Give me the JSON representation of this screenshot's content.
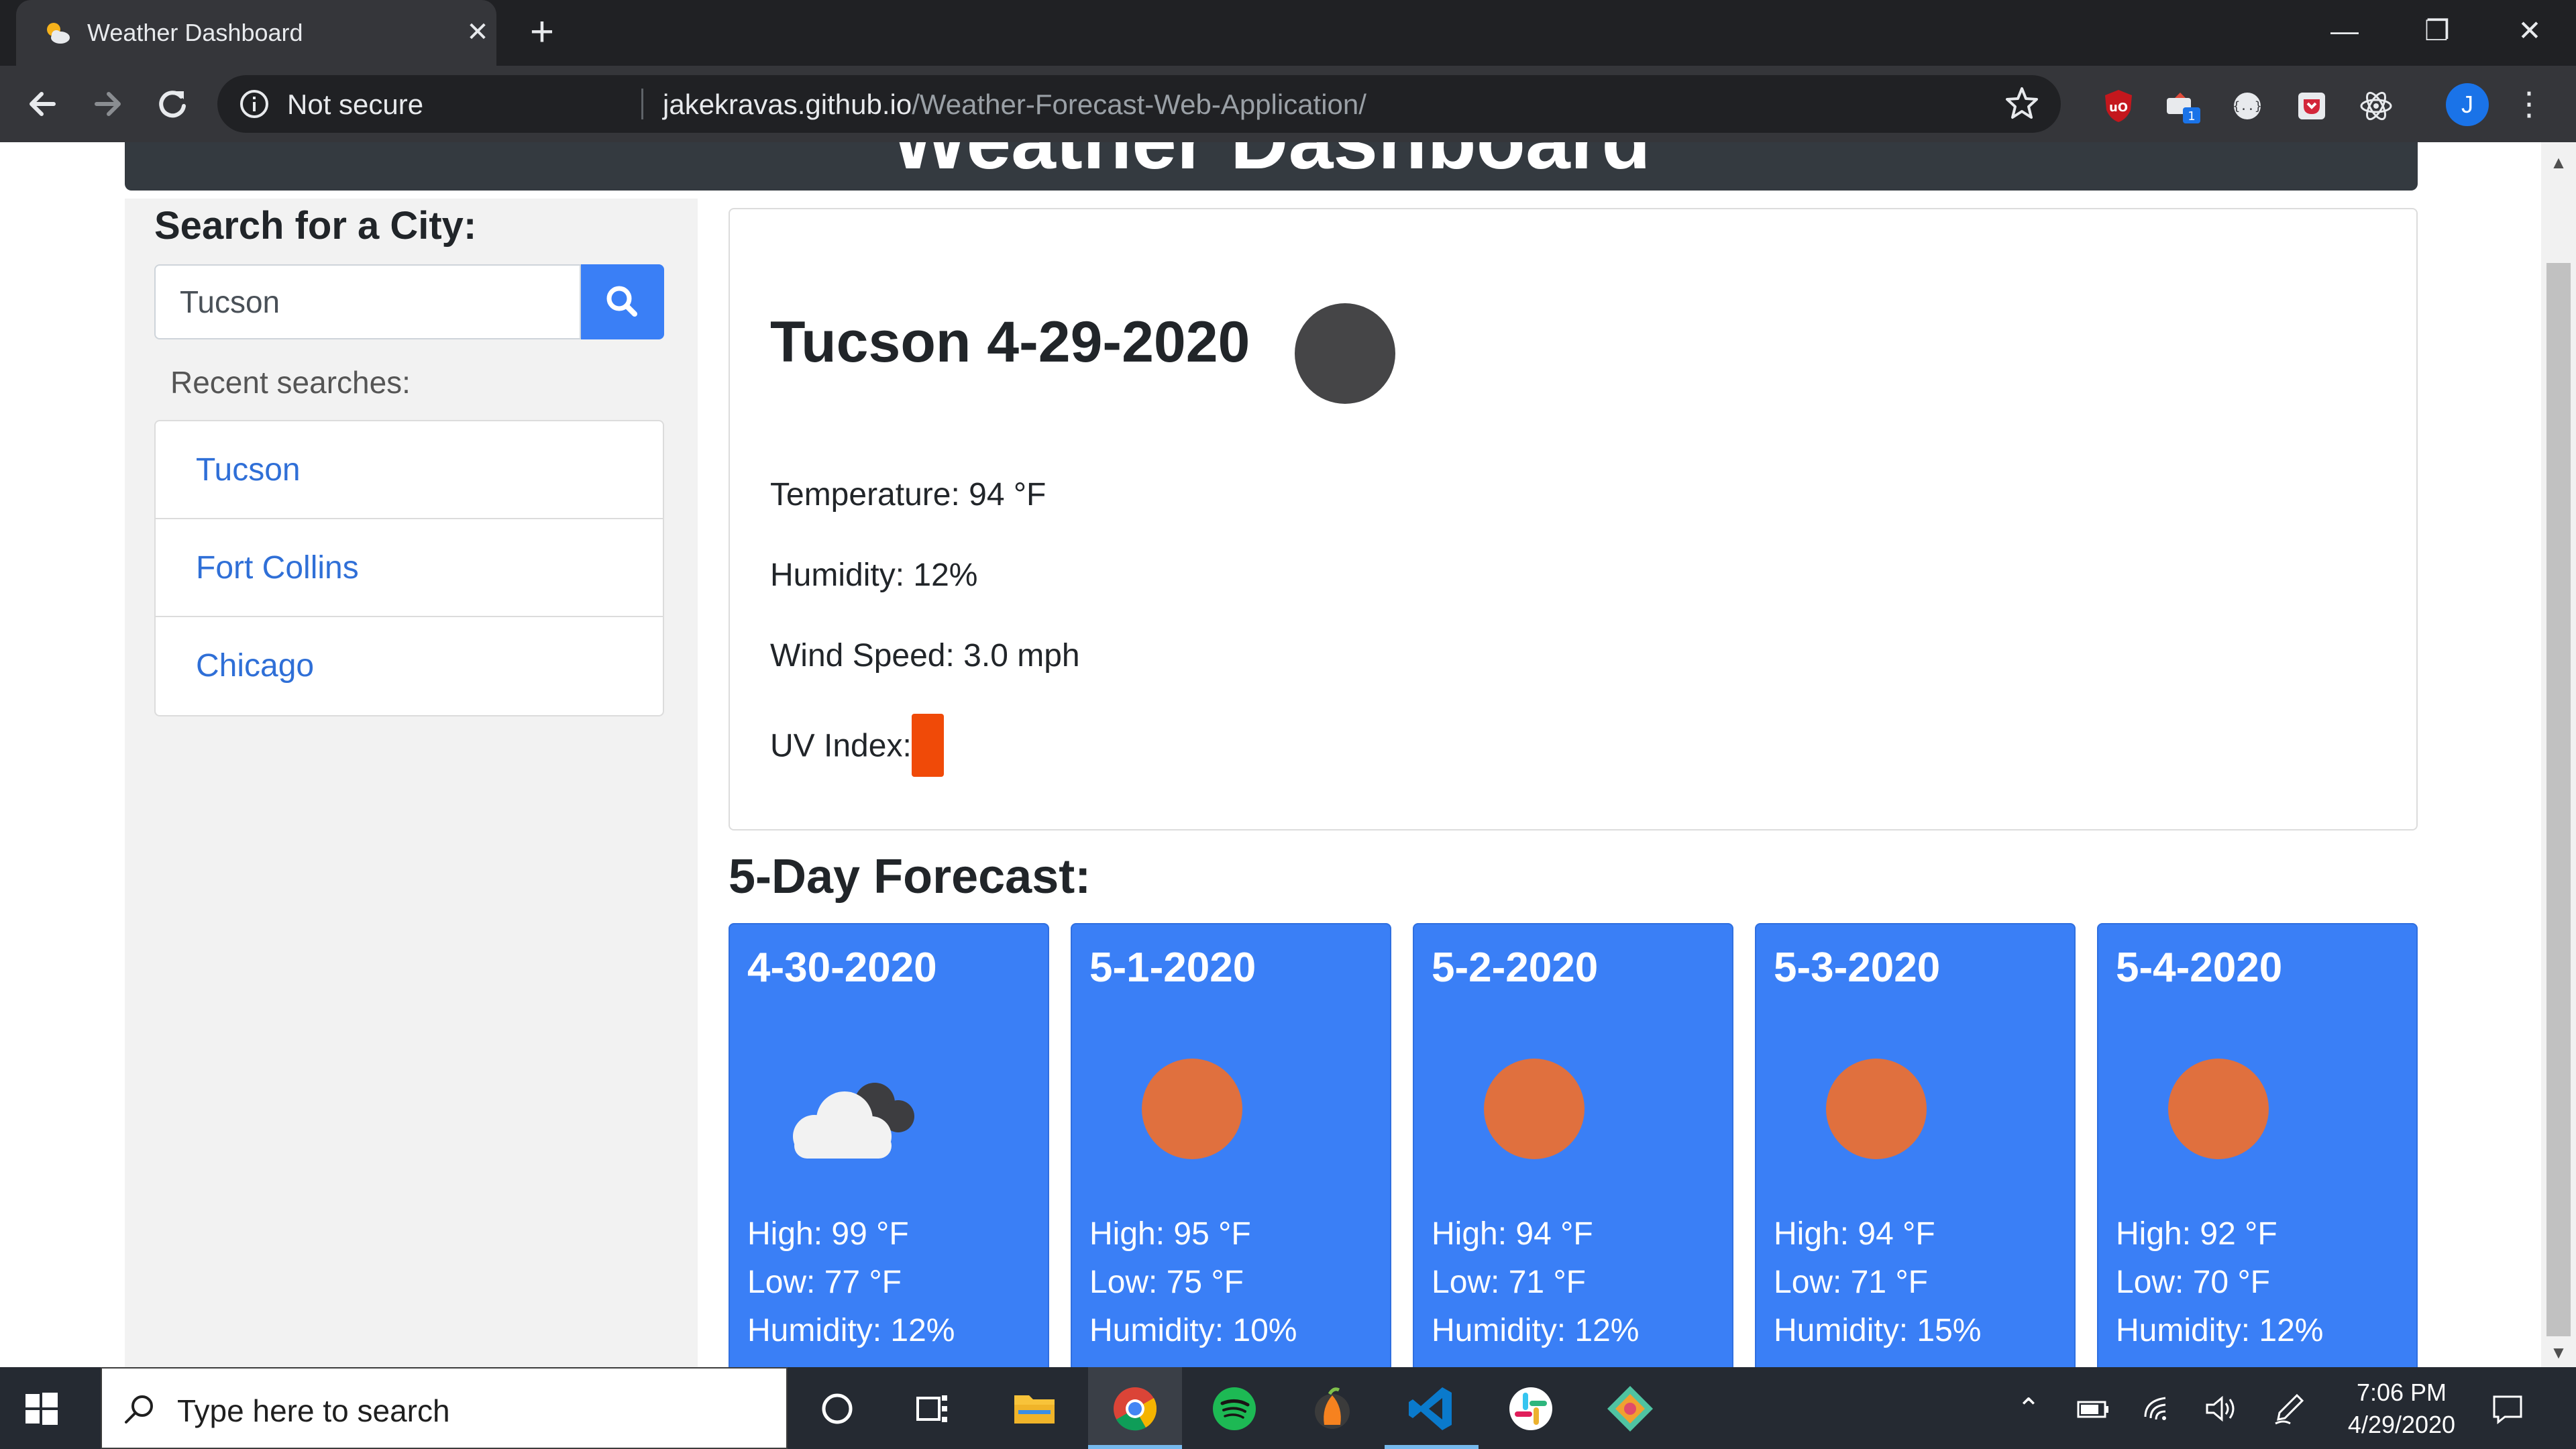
{
  "browser": {
    "tab_title": "Weather Dashboard",
    "tab_close": "✕",
    "new_tab": "+",
    "window_controls": {
      "minimize": "—",
      "restore": "❐",
      "close": "✕"
    },
    "security_label": "Not secure",
    "url_host": "jakekravas.github.io",
    "url_path": "/Weather-Forecast-Web-Application/",
    "extensions": [
      "ublock-origin-icon",
      "pin-extension-icon",
      "json-viewer-icon",
      "pocket-icon",
      "react-devtools-icon"
    ],
    "ext_badge": "1",
    "profile_initial": "J"
  },
  "page": {
    "header_title": "Weather Dashboard",
    "search": {
      "heading": "Search for a City:",
      "value": "Tucson",
      "recent_label": "Recent searches:",
      "recent": [
        "Tucson",
        "Fort Collins",
        "Chicago"
      ]
    },
    "today": {
      "title": "Tucson 4-29-2020",
      "icon": "moon-icon",
      "temperature": "Temperature: 94 °F",
      "humidity": "Humidity: 12%",
      "wind": "Wind Speed: 3.0 mph",
      "uv_label": "UV Index:",
      "uv_color": "#f04a08"
    },
    "forecast_heading": "5-Day Forecast:",
    "forecast": [
      {
        "date": "4-30-2020",
        "icon": "cloud-icon",
        "high": "High: 99 °F",
        "low": "Low: 77 °F",
        "humidity": "Humidity: 12%"
      },
      {
        "date": "5-1-2020",
        "icon": "sun-icon",
        "high": "High: 95 °F",
        "low": "Low: 75 °F",
        "humidity": "Humidity: 10%"
      },
      {
        "date": "5-2-2020",
        "icon": "sun-icon",
        "high": "High: 94 °F",
        "low": "Low: 71 °F",
        "humidity": "Humidity: 12%"
      },
      {
        "date": "5-3-2020",
        "icon": "sun-icon",
        "high": "High: 94 °F",
        "low": "Low: 71 °F",
        "humidity": "Humidity: 15%"
      },
      {
        "date": "5-4-2020",
        "icon": "sun-icon",
        "high": "High: 92 °F",
        "low": "Low: 70 °F",
        "humidity": "Humidity: 12%"
      }
    ],
    "colors": {
      "card_blue": "#3a7ff6",
      "sun_orange": "#e0703e",
      "link_blue": "#2f6fd7"
    }
  },
  "taskbar": {
    "search_placeholder": "Type here to search",
    "apps": [
      "cortana-icon",
      "task-view-icon",
      "file-explorer-icon",
      "chrome-icon",
      "spotify-icon",
      "fl-studio-icon",
      "vscode-icon",
      "slack-icon",
      "gitkraken-icon"
    ],
    "time": "7:06 PM",
    "date": "4/29/2020"
  }
}
